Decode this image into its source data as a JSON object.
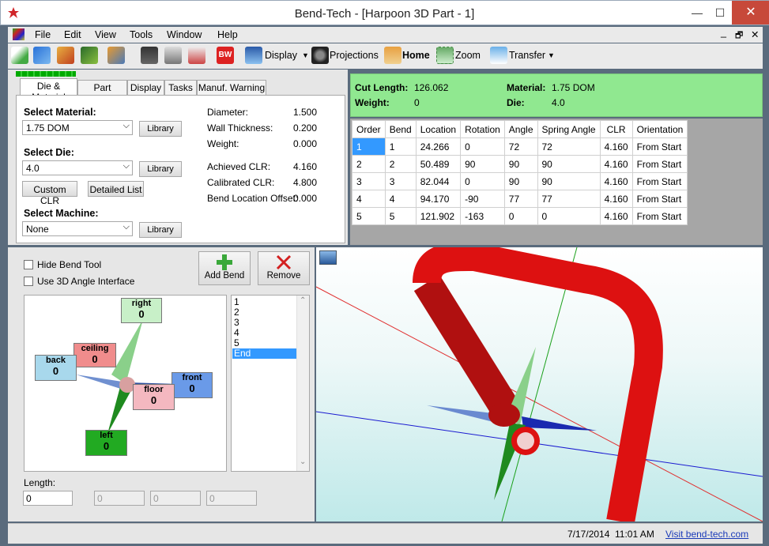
{
  "window": {
    "title": "Bend-Tech - [Harpoon 3D Part - 1]",
    "min": "—",
    "max": "☐",
    "close": "✕"
  },
  "menu": {
    "items": [
      "File",
      "Edit",
      "View",
      "Tools",
      "Window",
      "Help"
    ],
    "mdi_controls": [
      "_",
      "🗗",
      "✕"
    ]
  },
  "toolbar": {
    "display": "Display",
    "projections": "Projections",
    "home": "Home",
    "zoom": "Zoom",
    "transfer": "Transfer"
  },
  "tabs": [
    "Die & Material",
    "Part Details",
    "Display",
    "Tasks",
    "Manuf. Warning"
  ],
  "die_material": {
    "select_material_label": "Select Material:",
    "material_value": "1.75 DOM",
    "library_label": "Library",
    "select_die_label": "Select Die:",
    "die_value": "4.0",
    "custom_clr_label": "Custom CLR",
    "detailed_list_label": "Detailed List",
    "select_machine_label": "Select Machine:",
    "machine_value": "None",
    "props": [
      {
        "label": "Diameter:",
        "value": "1.500"
      },
      {
        "label": "Wall Thickness:",
        "value": "0.200"
      },
      {
        "label": "Weight:",
        "value": "0.000"
      },
      {
        "label": "Achieved CLR:",
        "value": "4.160"
      },
      {
        "label": "Calibrated CLR:",
        "value": "4.800"
      },
      {
        "label": "Bend Location Offset:",
        "value": "0.000"
      }
    ]
  },
  "info": {
    "cut_length_label": "Cut Length:",
    "cut_length": "126.062",
    "weight_label": "Weight:",
    "weight": "0",
    "material_label": "Material:",
    "material": "1.75 DOM",
    "die_label": "Die:",
    "die": "4.0"
  },
  "grid": {
    "columns": [
      "Order",
      "Bend",
      "Location",
      "Rotation",
      "Angle",
      "Spring Angle",
      "CLR",
      "Orientation"
    ],
    "rows": [
      [
        "1",
        "1",
        "24.266",
        "0",
        "72",
        "72",
        "4.160",
        "From Start"
      ],
      [
        "2",
        "2",
        "50.489",
        "90",
        "90",
        "90",
        "4.160",
        "From Start"
      ],
      [
        "3",
        "3",
        "82.044",
        "0",
        "90",
        "90",
        "4.160",
        "From Start"
      ],
      [
        "4",
        "4",
        "94.170",
        "-90",
        "77",
        "77",
        "4.160",
        "From Start"
      ],
      [
        "5",
        "5",
        "121.902",
        "-163",
        "0",
        "0",
        "4.160",
        "From Start"
      ]
    ]
  },
  "bend_tool": {
    "hide_bend_tool": "Hide Bend Tool",
    "use_3d_angle": "Use 3D Angle Interface",
    "add_bend": "Add Bend",
    "remove": "Remove",
    "directions": {
      "right": {
        "label": "right",
        "value": "0",
        "color": "#c8f0c8"
      },
      "ceiling": {
        "label": "ceiling",
        "value": "0",
        "color": "#f08c8c"
      },
      "back": {
        "label": "back",
        "value": "0",
        "color": "#a8d8ec"
      },
      "front": {
        "label": "front",
        "value": "0",
        "color": "#6a9ae8"
      },
      "floor": {
        "label": "floor",
        "value": "0",
        "color": "#f4b8c0"
      },
      "left": {
        "label": "left",
        "value": "0",
        "color": "#22aa22"
      }
    },
    "bend_list": [
      "1",
      "2",
      "3",
      "4",
      "5",
      "End"
    ],
    "length_label": "Length:",
    "length_value": "0",
    "disabled_values": [
      "0",
      "0",
      "0"
    ]
  },
  "status": {
    "date": "7/17/2014",
    "time": "11:01 AM",
    "link": "Visit bend-tech.com"
  },
  "colors": {
    "frame": "#5a6b7d",
    "info_green": "#90e890",
    "selection_blue": "#3399ff",
    "tube_red": "#dd1111"
  }
}
